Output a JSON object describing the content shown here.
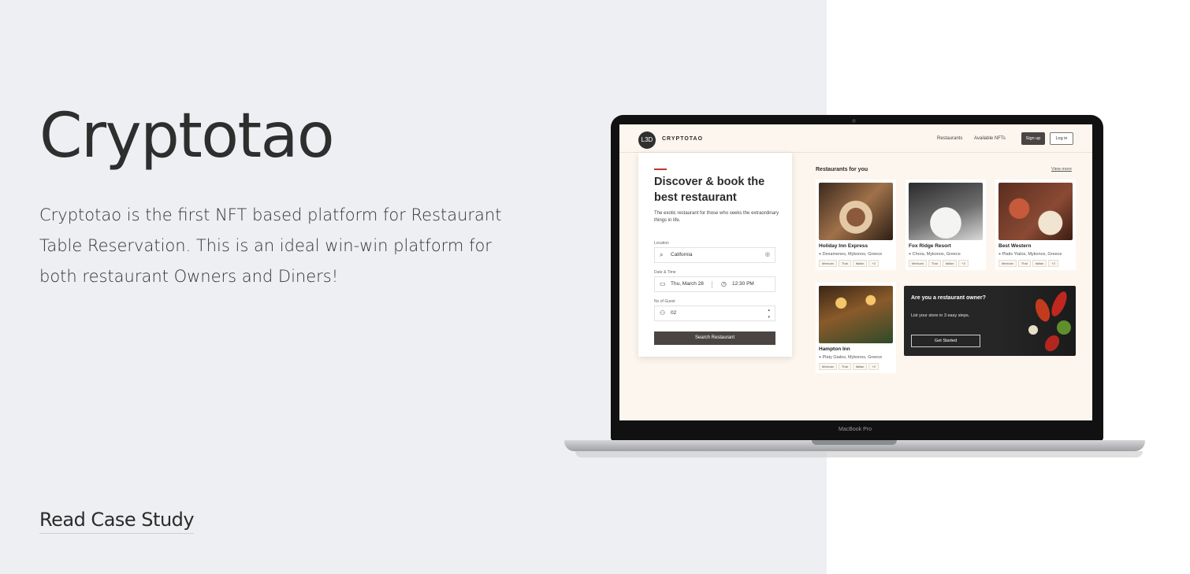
{
  "project": {
    "title": "Cryptotao",
    "description": "Cryptotao is the first NFT based platform for Restaurant Table Reservation. This is an ideal win-win platform for both restaurant Owners and Diners!",
    "cta": "Read Case Study"
  },
  "device_label": "MacBook Pro",
  "app": {
    "logo_text": "L3D",
    "brand": "Cryptotao",
    "nav": [
      "Restaurants",
      "Available NFTs"
    ],
    "signup": "Sign up",
    "login": "Log in",
    "search": {
      "heading": "Discover & book the best restaurant",
      "subtext": "The exotic restaurant for those who seeks the extraordinary things in life.",
      "location_label": "Location",
      "location_value": "California",
      "datetime_label": "Date & Time",
      "date_value": "Thu, March 28",
      "time_value": "12:30 PM",
      "guest_label": "No of Guest",
      "guest_value": "02",
      "button": "Search Restaurant"
    },
    "section_title": "Restaurants for you",
    "view_more": "View more",
    "restaurants": [
      {
        "name": "Holiday Inn Express",
        "location": "Dexamenes, Mykonos, Greece",
        "tags": [
          "Mexican",
          "Thai",
          "Italian",
          "+2"
        ]
      },
      {
        "name": "Fox Ridge Resort",
        "location": "Chora, Mykonos, Greece",
        "tags": [
          "Mexican",
          "Thai",
          "Italian",
          "+2"
        ]
      },
      {
        "name": "Best Western",
        "location": "Platis Yialos, Mykonos, Greece",
        "tags": [
          "Mexican",
          "Thai",
          "Italian",
          "+2"
        ]
      },
      {
        "name": "Hampton Inn",
        "location": "Platy Gialos, Mykonos, Greece",
        "tags": [
          "Mexican",
          "Thai",
          "Italian",
          "+2"
        ]
      }
    ],
    "owner": {
      "title": "Are you a restaurant owner?",
      "subtext": "List your store in 3 easy steps.",
      "button": "Get Started"
    }
  },
  "colors": {
    "left_panel_bg": "#eeeff2",
    "screen_bg": "#fdf6ee",
    "primary_button": "#4a4543",
    "accent": "#c0392b"
  }
}
